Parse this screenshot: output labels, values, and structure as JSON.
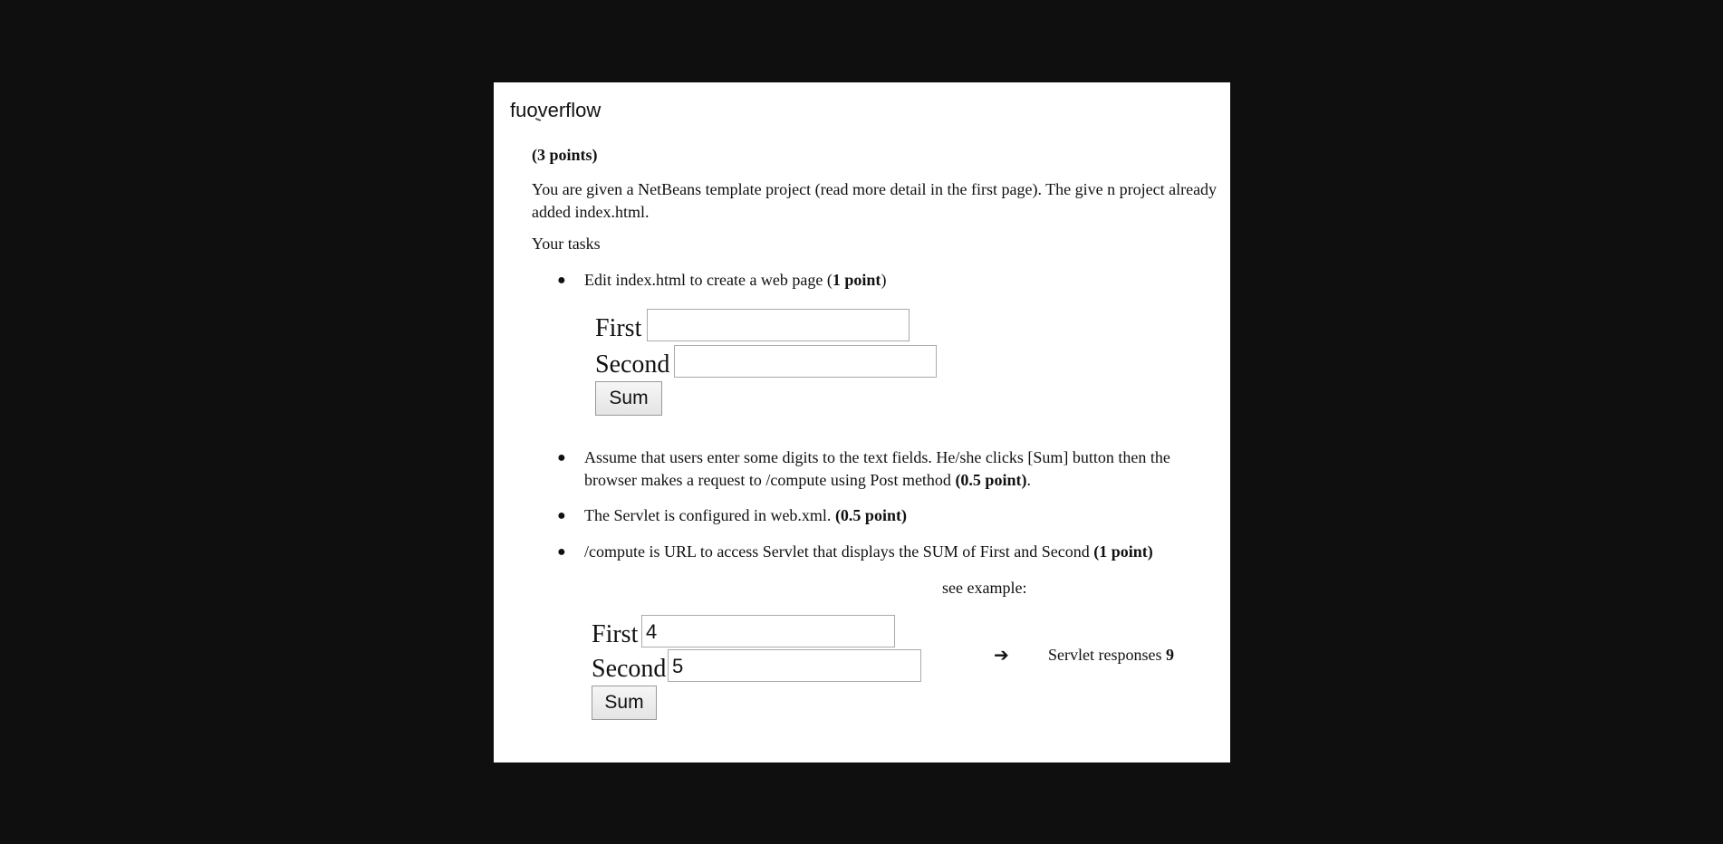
{
  "site": {
    "name": "fuoverflow"
  },
  "question": {
    "points": "(3 points)",
    "intro": "You are given a NetBeans template project (read more detail in the first page). The give  n project already added index.html.",
    "tasks_label": "Your tasks",
    "tasks": [
      {
        "text": "Edit index.html to create a web page (",
        "bold": "1 point",
        "tail": ")"
      },
      {
        "text": "Assume that users enter some digits to the text fields. He/she clicks [Sum] button then the browser makes a request to /compute using Post method ",
        "bold": "(0.5 point)",
        "tail": "."
      },
      {
        "text": "The Servlet is configured in web.xml. ",
        "bold": "(0.5 point)",
        "tail": ""
      },
      {
        "text": "/compute is URL to access Servlet that displays the SUM of First and Second ",
        "bold": "(1 point)",
        "tail": ""
      }
    ],
    "form_blank": {
      "first_label": "First",
      "second_label": "Second",
      "first_value": "",
      "second_value": "",
      "button_label": "Sum"
    },
    "see_example": "see example:",
    "form_example": {
      "first_label": "First",
      "second_label": "Second",
      "first_value": "4",
      "second_value": "5",
      "button_label": "Sum"
    },
    "response_text": "Servlet responses ",
    "response_value": "9"
  }
}
